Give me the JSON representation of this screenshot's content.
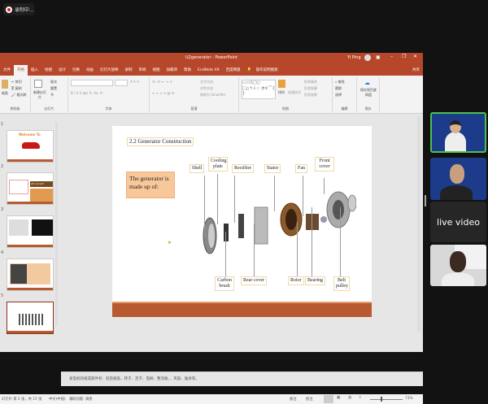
{
  "recording": {
    "label": "录制中..."
  },
  "window": {
    "title": "U2generator - PowerPoint",
    "user": "Yi Ping",
    "share": "共享"
  },
  "tabs": [
    "文件",
    "开始",
    "插入",
    "绘图",
    "设计",
    "切换",
    "动画",
    "幻灯片放映",
    "录制",
    "审阅",
    "视图",
    "加载项",
    "帮助",
    "EndNote X9",
    "百度网盘",
    "操作说明搜索"
  ],
  "active_tab": "开始",
  "ribbon": {
    "clipboard": {
      "label": "剪贴板",
      "paste": "粘贴",
      "cut": "剪切",
      "copy": "复制",
      "format_painter": "格式刷"
    },
    "slides": {
      "label": "幻灯片",
      "new_slide": "新建幻灯片",
      "layout": "版式",
      "reset": "重置",
      "section": "节"
    },
    "font": {
      "label": "字体"
    },
    "paragraph": {
      "label": "段落",
      "text_direction": "文字方向",
      "align_text": "对齐文本",
      "smartart": "转换为 SmartArt"
    },
    "drawing": {
      "label": "绘图",
      "arrange": "排列",
      "quick_styles": "快速样式",
      "shape_fill": "形状填充",
      "shape_outline": "形状轮廓",
      "shape_effects": "形状效果"
    },
    "editing": {
      "label": "编辑",
      "find": "查找",
      "replace": "替换",
      "select": "选择"
    },
    "save": {
      "label": "保存",
      "save_baidu": "保存到百度网盘"
    }
  },
  "thumbnails": [
    {
      "num": "1",
      "title": "Welcome To"
    },
    {
      "num": "2",
      "title": "AS current"
    },
    {
      "num": "3",
      "title": ""
    },
    {
      "num": "4",
      "title": ""
    },
    {
      "num": "5",
      "title": ""
    }
  ],
  "slide": {
    "title": "2.2 Generator Construction",
    "intro": "The generator is made up of:",
    "labels_top": [
      "Shell",
      "Cooling plate",
      "Rectifier",
      "Stator",
      "Fan",
      "Front cover"
    ],
    "labels_bottom": [
      "Carbon brush",
      "Rear cover",
      "Rotor",
      "Bearing",
      "Belt pulley"
    ],
    "accent": "#b85a30"
  },
  "notes": "发电机的组成部件有：前后端盖、转子、定子、电刷、整流板、、风扇、轴承等。",
  "status": {
    "slide_count": "幻灯片 第 5 张，共 15 张",
    "language": "中文(中国)",
    "accessibility": "辅助功能: 调查",
    "notes": "备注",
    "comments": "批注",
    "zoom": "73%",
    "zoom_percent": 73
  },
  "videos": [
    {
      "name": "participant-1",
      "active": true
    },
    {
      "name": "participant-2"
    },
    {
      "name": "live",
      "label": "live video"
    },
    {
      "name": "participant-4"
    }
  ]
}
